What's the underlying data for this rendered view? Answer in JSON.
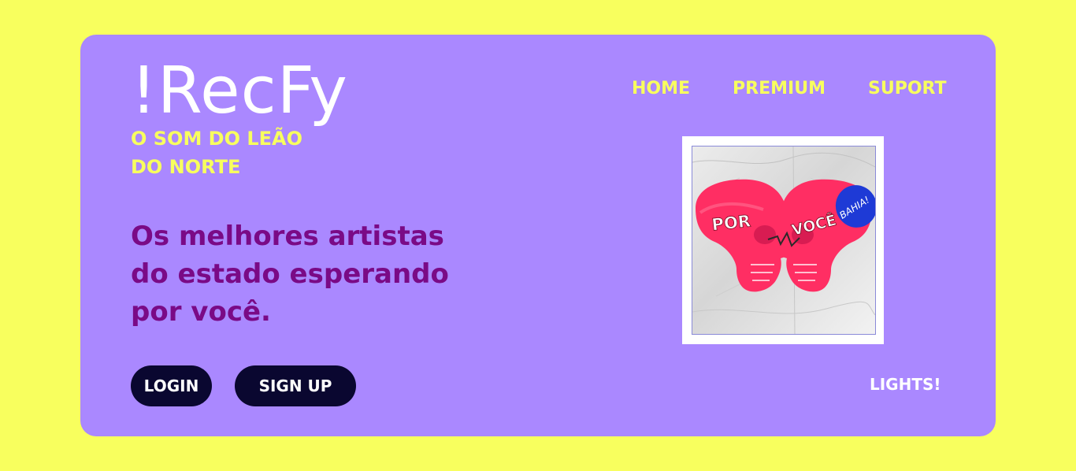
{
  "brand": {
    "logo": "!RecFy",
    "tagline": "O SOM DO LEÃO DO NORTE"
  },
  "nav": {
    "items": [
      {
        "label": "HOME"
      },
      {
        "label": "PREMIUM"
      },
      {
        "label": "SUPORT"
      }
    ]
  },
  "hero": {
    "headline": "Os melhores artistas do estado esperando por você."
  },
  "album": {
    "left_text": "POR",
    "right_text": "VOCÊ",
    "sticker_text": "BAHIA!"
  },
  "actions": {
    "login_label": "LOGIN",
    "signup_label": "SIGN UP",
    "lights_label": "LIGHTS!"
  },
  "colors": {
    "page_background": "#f8ff5e",
    "card_background": "#aa88ff",
    "accent_yellow": "#f8ff5e",
    "headline_purple": "#7a0a86",
    "button_dark": "#0a0730",
    "skull_pink": "#ff2e63",
    "sticker_blue": "#1e3ad6"
  }
}
